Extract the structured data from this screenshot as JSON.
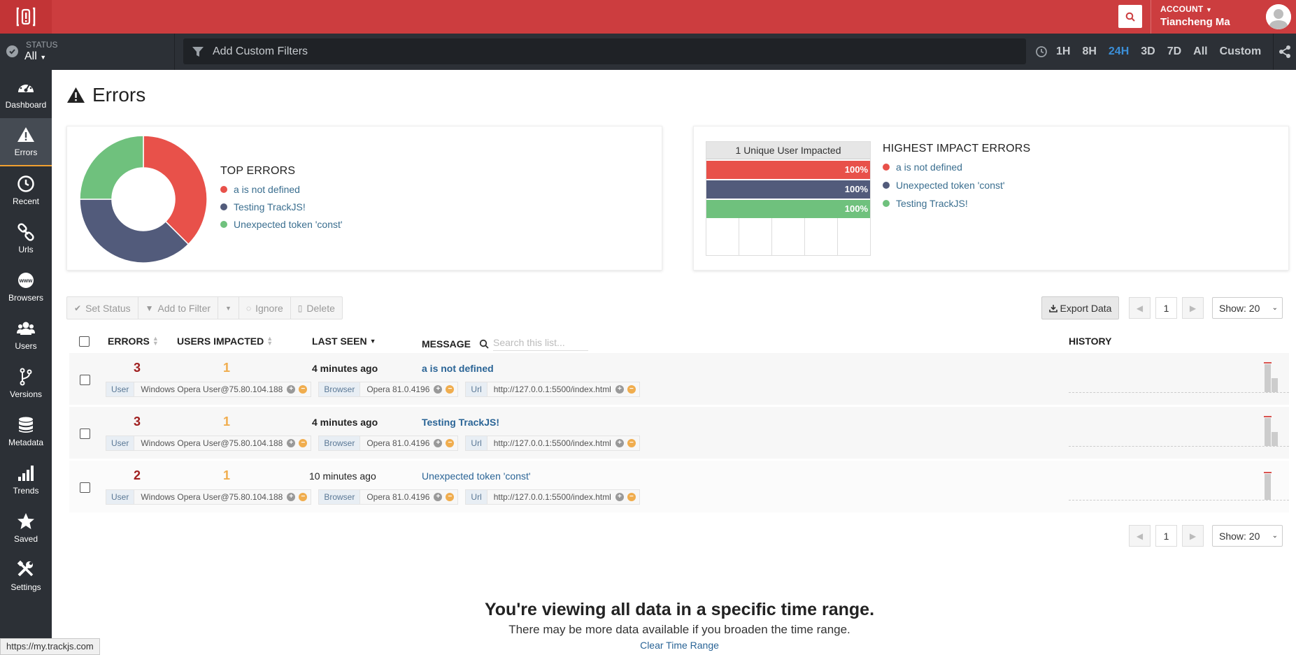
{
  "topbar": {
    "account_label": "ACCOUNT",
    "account_name": "Tiancheng Ma"
  },
  "filterbar": {
    "status_label": "STATUS",
    "status_value": "All",
    "filter_placeholder": "Add Custom Filters",
    "time_ranges": [
      "1H",
      "8H",
      "24H",
      "3D",
      "7D",
      "All",
      "Custom"
    ],
    "active_range": "24H"
  },
  "sidebar": {
    "items": [
      {
        "label": "Dashboard",
        "icon": "dashboard-icon"
      },
      {
        "label": "Errors",
        "icon": "warning-icon",
        "active": true
      },
      {
        "label": "Recent",
        "icon": "clock-icon"
      },
      {
        "label": "Urls",
        "icon": "link-icon"
      },
      {
        "label": "Browsers",
        "icon": "www-icon"
      },
      {
        "label": "Users",
        "icon": "users-icon"
      },
      {
        "label": "Versions",
        "icon": "branch-icon"
      },
      {
        "label": "Metadata",
        "icon": "database-icon"
      },
      {
        "label": "Trends",
        "icon": "bar-chart-icon"
      },
      {
        "label": "Saved",
        "icon": "star-icon"
      },
      {
        "label": "Settings",
        "icon": "tools-icon"
      }
    ]
  },
  "page": {
    "title": "Errors"
  },
  "top_errors": {
    "title": "TOP ERRORS",
    "items": [
      {
        "label": "a is not defined",
        "color": "#e8514a"
      },
      {
        "label": "Testing TrackJS!",
        "color": "#525b7b"
      },
      {
        "label": "Unexpected token 'const'",
        "color": "#6fc17d"
      }
    ],
    "shares": [
      3,
      3,
      2
    ]
  },
  "highest_impact": {
    "title": "HIGHEST IMPACT ERRORS",
    "chart_header": "1 Unique User Impacted",
    "bars": [
      {
        "value": "100%",
        "color": "#e8514a"
      },
      {
        "value": "100%",
        "color": "#525b7b"
      },
      {
        "value": "100%",
        "color": "#6fc17d"
      }
    ],
    "items": [
      {
        "label": "a is not defined",
        "color": "#e8514a"
      },
      {
        "label": "Unexpected token 'const'",
        "color": "#525b7b"
      },
      {
        "label": "Testing TrackJS!",
        "color": "#6fc17d"
      }
    ]
  },
  "toolbar": {
    "set_status": "Set Status",
    "add_to_filter": "Add to Filter",
    "ignore": "Ignore",
    "delete": "Delete",
    "export": "Export Data",
    "page": "1",
    "show": "Show: 20"
  },
  "table": {
    "headers": {
      "errors": "ERRORS",
      "users": "USERS IMPACTED",
      "last_seen": "LAST SEEN",
      "message": "MESSAGE",
      "search_placeholder": "Search this list...",
      "history": "HISTORY"
    },
    "rows": [
      {
        "errors": "3",
        "users": "1",
        "last_seen": "4 minutes ago",
        "message": "a is not defined",
        "bold": true,
        "user_key": "User",
        "user_val": "Windows Opera User@75.80.104.188",
        "browser_key": "Browser",
        "browser_val": "Opera 81.0.4196",
        "url_key": "Url",
        "url_val": "http://127.0.0.1:5500/index.html",
        "history": [
          0.9,
          0.45
        ]
      },
      {
        "errors": "3",
        "users": "1",
        "last_seen": "4 minutes ago",
        "message": "Testing TrackJS!",
        "bold": true,
        "user_key": "User",
        "user_val": "Windows Opera User@75.80.104.188",
        "browser_key": "Browser",
        "browser_val": "Opera 81.0.4196",
        "url_key": "Url",
        "url_val": "http://127.0.0.1:5500/index.html",
        "history": [
          0.9,
          0.45
        ]
      },
      {
        "errors": "2",
        "users": "1",
        "last_seen": "10 minutes ago",
        "message": "Unexpected token 'const'",
        "bold": false,
        "user_key": "User",
        "user_val": "Windows Opera User@75.80.104.188",
        "browser_key": "Browser",
        "browser_val": "Opera 81.0.4196",
        "url_key": "Url",
        "url_val": "http://127.0.0.1:5500/index.html",
        "history": [
          0.85
        ]
      }
    ]
  },
  "footer": {
    "headline": "You're viewing all data in a specific time range.",
    "sub": "There may be more data available if you broaden the time range.",
    "link": "Clear Time Range"
  },
  "statusbar": {
    "url": "https://my.trackjs.com"
  }
}
